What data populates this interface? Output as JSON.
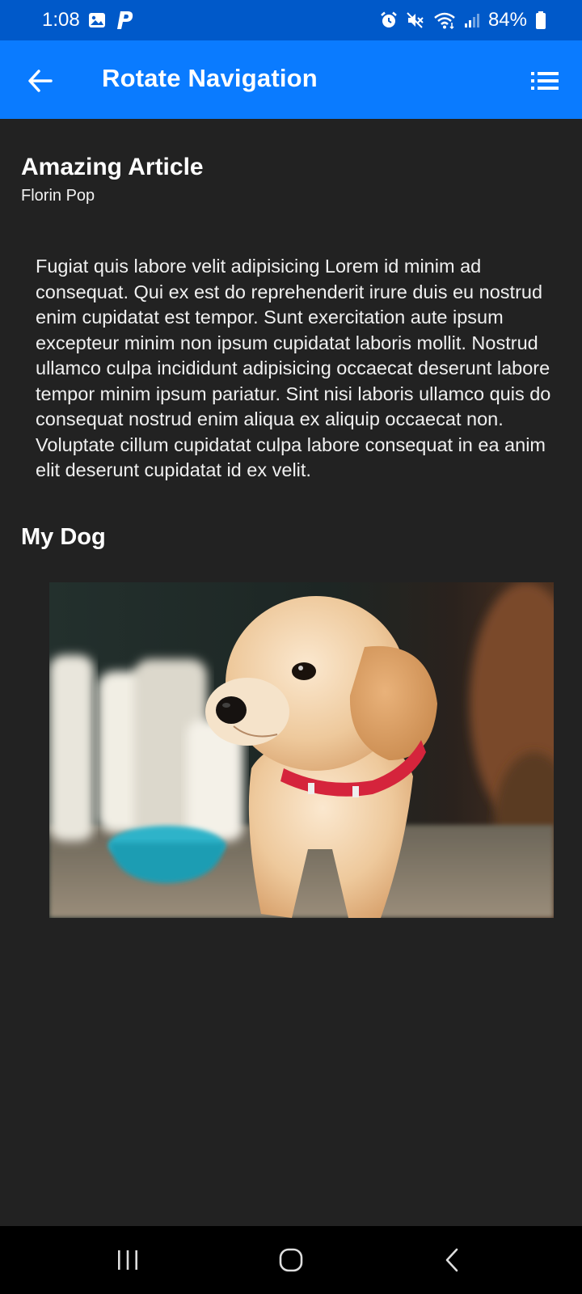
{
  "status_bar": {
    "time": "1:08",
    "battery": "84%",
    "icons": [
      "gallery-icon",
      "p-app-icon",
      "alarm-icon",
      "mute-icon",
      "wifi-icon",
      "signal-icon",
      "battery-icon"
    ]
  },
  "app_bar": {
    "title": "Rotate Navigation",
    "back_icon": "arrow-left-icon",
    "menu_icon": "list-menu-icon",
    "background": "#0a7bff"
  },
  "article": {
    "title": "Amazing Article",
    "author": "Florin Pop",
    "body": "Fugiat quis labore velit adipisicing Lorem id minim ad consequat. Qui ex est do reprehenderit irure duis eu nostrud enim cupidatat est tempor. Sunt exercitation aute ipsum excepteur minim non ipsum cupidatat laboris mollit. Nostrud ullamco culpa incididunt adipisicing occaecat deserunt labore tempor minim ipsum pariatur. Sint nisi laboris ullamco quis do consequat nostrud enim aliqua ex aliquip occaecat non. Voluptate cillum cupidatat culpa labore consequat in ea anim elit deserunt cupidatat id ex velit.",
    "section_title": "My Dog"
  },
  "nav_bar": {
    "icons": [
      "recent-apps-icon",
      "home-icon",
      "back-icon"
    ]
  },
  "colors": {
    "status_bar": "#0059c9",
    "app_bar": "#0a7bff",
    "page_background": "#222222",
    "nav_bar": "#000000"
  }
}
